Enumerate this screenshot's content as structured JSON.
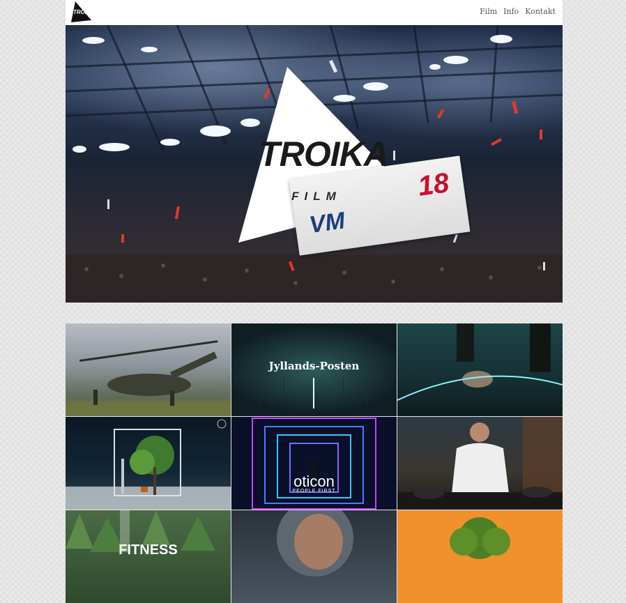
{
  "header": {
    "logo_alt": "TROIKA FILM",
    "nav": [
      {
        "label": "Film"
      },
      {
        "label": "Info"
      },
      {
        "label": "Kontakt"
      }
    ]
  },
  "hero": {
    "title": "TROIKA",
    "subtitle": "FILM",
    "banner_left": "VM",
    "banner_number": "18"
  },
  "tiles": [
    {
      "id": "helicopter",
      "label": ""
    },
    {
      "id": "jyllands-posten",
      "label": "Jyllands-Posten"
    },
    {
      "id": "feet-circle",
      "label": ""
    },
    {
      "id": "tree-cube",
      "label": ""
    },
    {
      "id": "oticon",
      "label": "oticon",
      "sublabel": "PEOPLE FIRST"
    },
    {
      "id": "chef",
      "label": ""
    },
    {
      "id": "fitness",
      "label": "FITNESS"
    },
    {
      "id": "woman-hood",
      "label": ""
    },
    {
      "id": "orange-tree",
      "label": ""
    }
  ],
  "colors": {
    "accent_red": "#c8102e",
    "orange_tile": "#f0912e",
    "nav_text": "#555555"
  }
}
